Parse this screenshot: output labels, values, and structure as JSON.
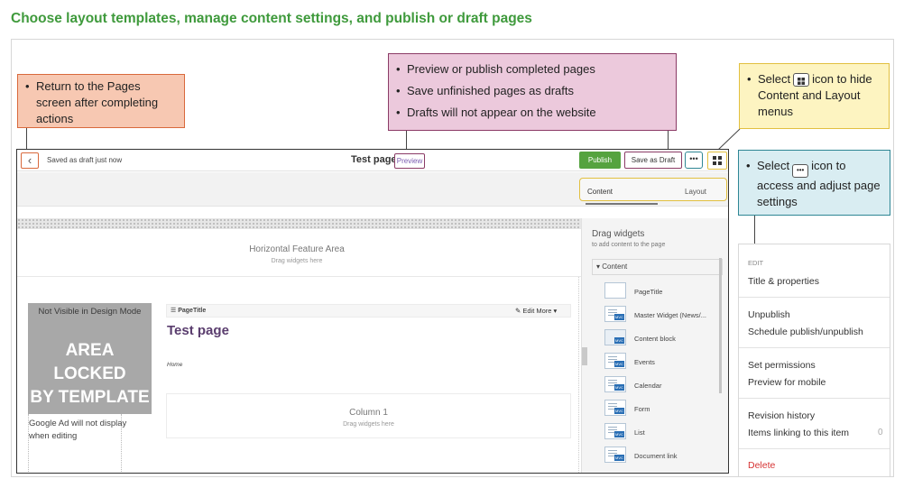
{
  "heading": "Choose layout templates, manage content settings, and publish or draft pages",
  "callouts": {
    "back": [
      "Return to the Pages screen after completing actions"
    ],
    "publish": [
      "Preview or publish completed pages",
      "Save unfinished pages as drafts",
      "Drafts will not appear on the website"
    ],
    "grid_pre": "Select",
    "grid_post": "icon to hide Content and Layout menus",
    "more_pre": "Select",
    "more_post": "icon to access and adjust page settings"
  },
  "topbar": {
    "saved_status": "Saved as draft just now",
    "page_title": "Test page",
    "preview_label": "Preview",
    "publish_label": "Publish",
    "save_draft_label": "Save as Draft",
    "more_label": "•••"
  },
  "tabs": {
    "content": "Content",
    "layout": "Layout"
  },
  "canvas": {
    "hfa_title": "Horizontal Feature Area",
    "hfa_sub": "Drag widgets here",
    "locked_top": "Not Visible in Design Mode",
    "locked_line1": "AREA LOCKED",
    "locked_line2": "BY TEMPLATE",
    "ad_text": "Google Ad will not display when editing",
    "widget_name": "☰ PageTitle",
    "widget_actions": "✎ Edit  More ▾",
    "page_title": "Test page",
    "breadcrumb": "Home",
    "column_title": "Column 1",
    "column_sub": "Drag widgets here"
  },
  "panel": {
    "title": "Drag widgets",
    "subtitle": "to add content to the page",
    "section": "▾ Content",
    "widgets": [
      "PageTitle",
      "Master Widget (News/...",
      "Content block",
      "Events",
      "Calendar",
      "Form",
      "List",
      "Document link"
    ]
  },
  "menu": {
    "edit_header": "EDIT",
    "title_properties": "Title & properties",
    "unpublish": "Unpublish",
    "schedule": "Schedule publish/unpublish",
    "permissions": "Set permissions",
    "preview_mobile": "Preview for mobile",
    "revision_history": "Revision history",
    "items_linking": "Items linking to this item",
    "items_linking_count": "0",
    "delete": "Delete"
  },
  "colors": {
    "heading": "#3f9a3c",
    "publish_green": "#55a33f",
    "callout_orange": "#f7c8b2",
    "callout_magenta": "#ecc9dc",
    "callout_yellow": "#fdf4c1",
    "callout_teal": "#d9edf2",
    "delete_red": "#d63333"
  }
}
